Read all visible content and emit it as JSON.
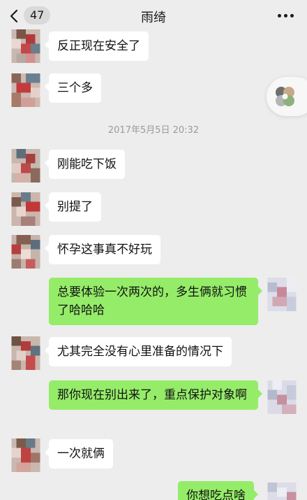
{
  "header": {
    "back_count": "47",
    "title": "雨绮"
  },
  "timestamp": "2017年5月5日 20:32",
  "messages": [
    {
      "side": "left",
      "text": "反正现在安全了"
    },
    {
      "side": "left",
      "text": "三个多"
    },
    {
      "side": "left",
      "text": "刚能吃下饭"
    },
    {
      "side": "left",
      "text": "别提了"
    },
    {
      "side": "left",
      "text": "怀孕这事真不好玩"
    },
    {
      "side": "right",
      "text": "总要体验一次两次的，多生俩就习惯了哈哈哈"
    },
    {
      "side": "left",
      "text": "尤其完全没有心里准备的情况下"
    },
    {
      "side": "right",
      "text": "那你现在别出来了，重点保护对象啊"
    },
    {
      "side": "left",
      "text": "一次就俩"
    },
    {
      "side": "right",
      "text": "你想吃点啥"
    }
  ],
  "colors": {
    "background": "#ededed",
    "bubble_left": "#ffffff",
    "bubble_right": "#95ec69"
  },
  "icons": [
    "back-arrow-icon",
    "more-dots-icon",
    "floating-window-icon"
  ]
}
